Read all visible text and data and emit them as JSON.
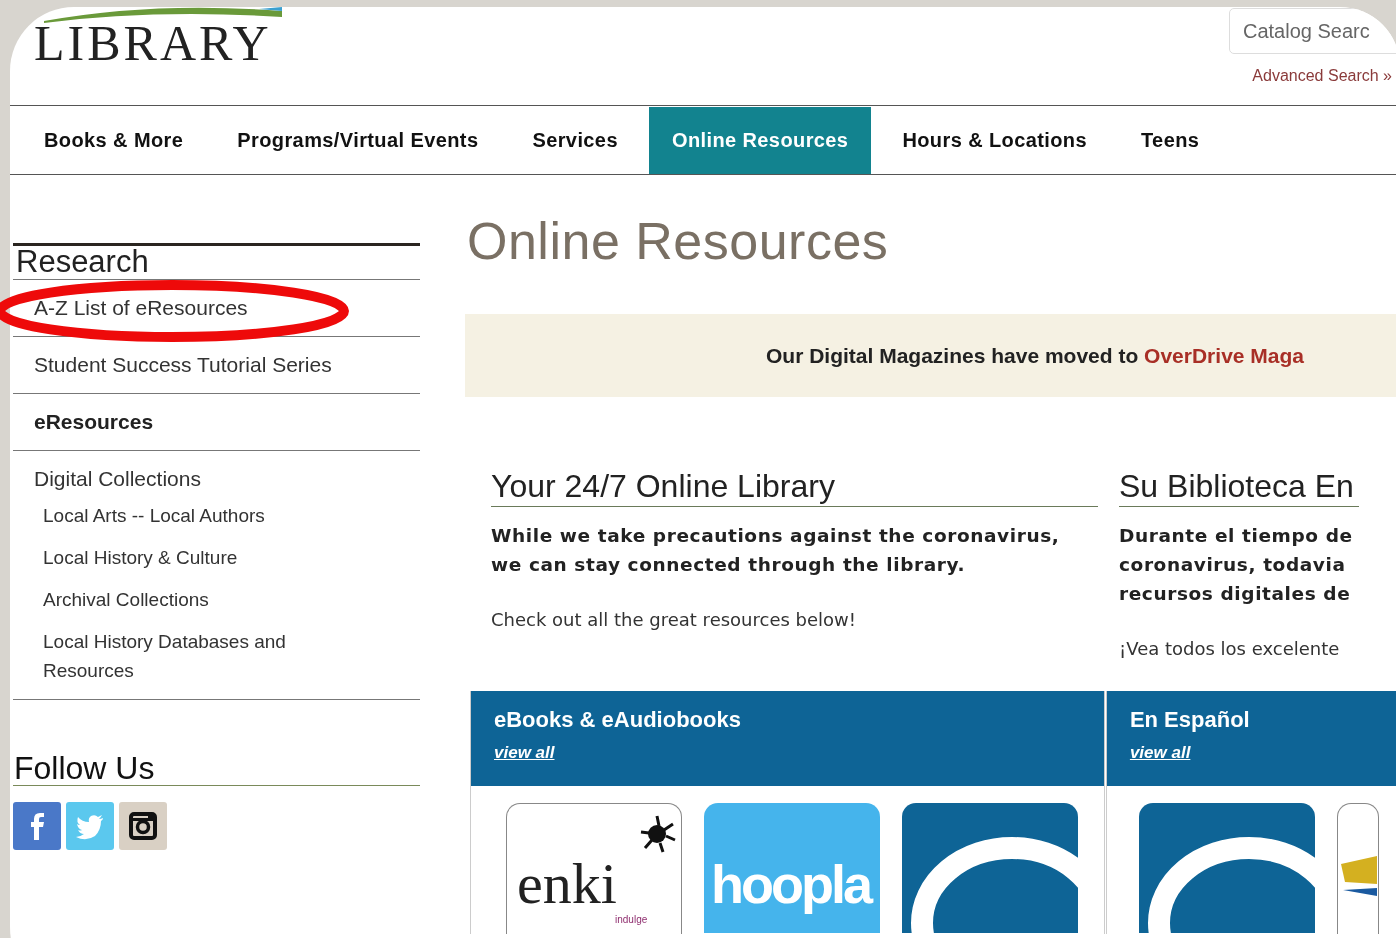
{
  "logo": {
    "text": "LIBRARY"
  },
  "search": {
    "placeholder": "Catalog Searc",
    "advanced_link": "Advanced Search »"
  },
  "nav": [
    {
      "label": "Books & More",
      "selected": false
    },
    {
      "label": "Programs/Virtual Events",
      "selected": false
    },
    {
      "label": "Services",
      "selected": false
    },
    {
      "label": "Online Resources",
      "selected": true
    },
    {
      "label": "Hours & Locations",
      "selected": false
    },
    {
      "label": "Teens",
      "selected": false
    }
  ],
  "sidebar": {
    "items": [
      {
        "label": "Research",
        "kind": "heading"
      },
      {
        "label": "A-Z List of eResources",
        "kind": "link"
      },
      {
        "label": "Student Success Tutorial Series",
        "kind": "link"
      },
      {
        "label": "eResources",
        "kind": "current"
      },
      {
        "label": "Digital Collections",
        "kind": "link",
        "children": [
          {
            "label": "Local Arts -- Local Authors"
          },
          {
            "label": "Local History & Culture"
          },
          {
            "label": "Archival Collections"
          },
          {
            "label": "Local History Databases and Resources"
          }
        ]
      }
    ]
  },
  "follow_us": {
    "title": "Follow Us"
  },
  "annotation": {
    "kind": "ellipse"
  },
  "main": {
    "title": "Online Resources",
    "banner": {
      "text": "Our Digital Magazines have moved to ",
      "link": "OverDrive Maga"
    },
    "columns": [
      {
        "heading": "Your 24/7 Online Library",
        "lead": "While we take precautions against the coronavirus, we can stay connected through the library.",
        "note": "Check out all the great resources below!"
      },
      {
        "heading": "Su Biblioteca En",
        "lead_lines": [
          "Durante el tiempo de",
          "coronavirus, todavia",
          "recursos digitales de"
        ],
        "note": "¡Vea todos los excelente"
      }
    ],
    "collections": [
      {
        "title": "eBooks & eAudiobooks",
        "link": "view all",
        "tiles": [
          {
            "kind": "enki",
            "text": "enki",
            "tagline": "indulge"
          },
          {
            "kind": "hoopla",
            "text": "hoopla"
          },
          {
            "kind": "overdrive"
          }
        ]
      },
      {
        "title": "En Español",
        "link": "view all",
        "tiles": [
          {
            "kind": "overdrive"
          },
          {
            "kind": "other"
          }
        ]
      }
    ]
  }
}
